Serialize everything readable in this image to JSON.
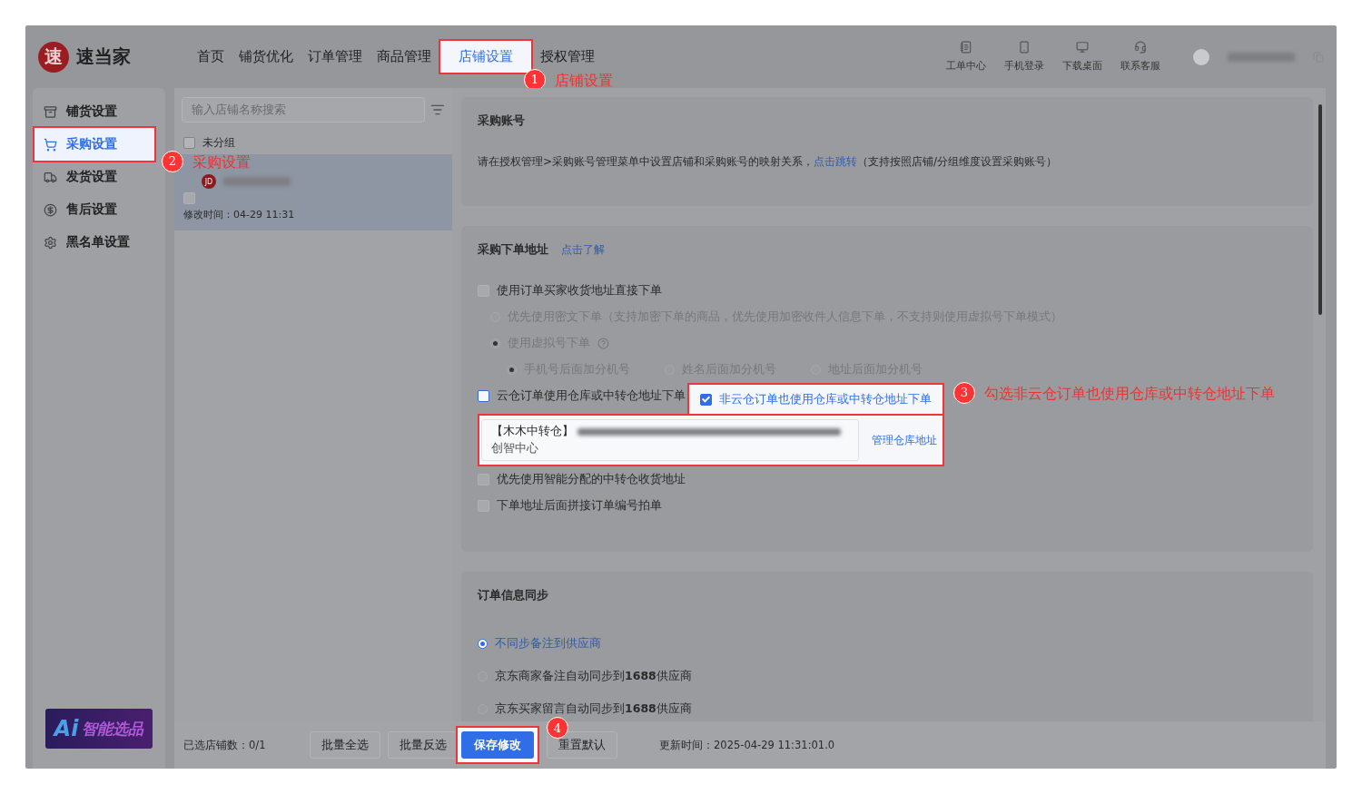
{
  "brand": {
    "mark": "速",
    "name": "速当家"
  },
  "nav": [
    {
      "label": "首页",
      "selected": false,
      "highlighted": false
    },
    {
      "label": "铺货优化",
      "selected": false,
      "highlighted": false
    },
    {
      "label": "订单管理",
      "selected": false,
      "highlighted": false
    },
    {
      "label": "商品管理",
      "selected": false,
      "highlighted": false
    },
    {
      "label": "店铺设置",
      "selected": true,
      "highlighted": true,
      "callout": {
        "number": "1",
        "text": "店铺设置"
      }
    },
    {
      "label": "授权管理",
      "selected": false,
      "highlighted": false
    }
  ],
  "top_actions": [
    {
      "label": "工单中心"
    },
    {
      "label": "手机登录"
    },
    {
      "label": "下载桌面"
    },
    {
      "label": "联系客服"
    }
  ],
  "sidebar": {
    "items": [
      {
        "label": "铺货设置",
        "selected": false,
        "highlighted": false
      },
      {
        "label": "采购设置",
        "selected": true,
        "highlighted": true,
        "callout": {
          "number": "2",
          "text": "采购设置"
        }
      },
      {
        "label": "发货设置",
        "selected": false,
        "highlighted": false
      },
      {
        "label": "售后设置",
        "selected": false,
        "highlighted": false
      },
      {
        "label": "黑名单设置",
        "selected": false,
        "highlighted": false
      }
    ],
    "ai_banner": {
      "mark": "Ai",
      "text": "智能选品"
    }
  },
  "shop_list": {
    "search": {
      "placeholder": "输入店铺名称搜索"
    },
    "groups": [
      {
        "label": "未分组",
        "checked": false
      }
    ],
    "shops": [
      {
        "badge": "JD",
        "modified": "修改时间：04-29 11:31",
        "checked": false,
        "selected": true
      }
    ],
    "selected_count": "已选店铺数：0/1",
    "buttons": [
      "批量全选",
      "批量反选"
    ]
  },
  "account_section": {
    "title": "采购账号",
    "text": "请在授权管理>采购账号管理菜单中设置店铺和采购账号的映射关系，",
    "link": "点击跳转",
    "note": "（支持按照店铺/分组维度设置采购账号）"
  },
  "address_section": {
    "title": "采购下单地址",
    "link": "点击了解",
    "options": [
      {
        "kind": "checkbox",
        "label": "使用订单买家收货地址直接下单",
        "checked": false,
        "children": [
          {
            "label": "优先使用密文下单（支持加密下单的商品，优先使用加密收件人信息下单，不支持则使用虚拟号下单模式）",
            "selected": false,
            "help": false
          },
          {
            "label": "使用虚拟号下单",
            "selected": true,
            "help": true,
            "children": [
              {
                "label": "手机号后面加分机号",
                "selected": true
              },
              {
                "label": "姓名后面加分机号",
                "selected": false
              },
              {
                "label": "地址后面加分机号",
                "selected": false
              }
            ]
          }
        ]
      },
      {
        "kind": "warehouse",
        "cloud": {
          "label": "云仓订单使用仓库或中转仓地址下单",
          "checked": false
        },
        "non_cloud": {
          "label": "非云仓订单也使用仓库或中转仓地址下单",
          "checked": true
        },
        "address": {
          "name": "【木木中转仓】",
          "line2": "创智中心"
        },
        "manage_link": "管理仓库地址",
        "callout": {
          "number": "3",
          "text": "勾选非云仓订单也使用仓库或中转仓地址下单"
        }
      },
      {
        "kind": "checkbox",
        "label": "优先使用智能分配的中转仓收货地址",
        "checked": false
      },
      {
        "kind": "checkbox",
        "label": "下单地址后面拼接订单编号拍单",
        "checked": false
      }
    ]
  },
  "sync_section": {
    "title": "订单信息同步",
    "options": [
      {
        "label": "不同步备注到供应商",
        "selected": true
      },
      {
        "label": "京东商家备注自动同步到**1688**供应商",
        "selected": false
      },
      {
        "label": "京东买家留言自动同步到**1688**供应商",
        "selected": false
      }
    ]
  },
  "footer": {
    "save": {
      "label": "保存修改",
      "highlighted": true,
      "callout": {
        "number": "4"
      }
    },
    "reset": "重置默认",
    "updated": "更新时间：2025-04-29 11:31:01.0"
  }
}
